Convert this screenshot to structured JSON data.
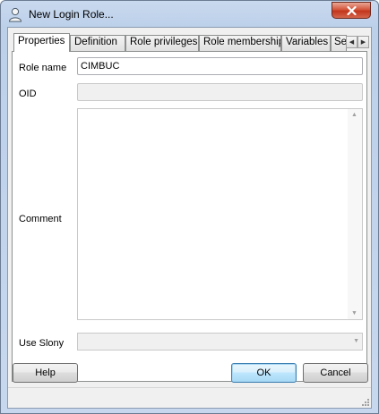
{
  "window": {
    "title": "New Login Role..."
  },
  "tabs": [
    {
      "label": "Properties",
      "active": true
    },
    {
      "label": "Definition"
    },
    {
      "label": "Role privileges"
    },
    {
      "label": "Role membership"
    },
    {
      "label": "Variables"
    },
    {
      "label": "Se"
    }
  ],
  "form": {
    "role_name": {
      "label": "Role name",
      "value": "CIMBUC"
    },
    "oid": {
      "label": "OID",
      "value": ""
    },
    "comment": {
      "label": "Comment",
      "value": ""
    },
    "use_slony": {
      "label": "Use Slony",
      "value": ""
    }
  },
  "buttons": {
    "help": "Help",
    "ok": "OK",
    "cancel": "Cancel"
  },
  "icons": {
    "title": "user-icon",
    "close": "close-icon",
    "scroll_left": "chevron-left-icon",
    "scroll_right": "chevron-right-icon",
    "dropdown": "chevron-down-icon"
  },
  "colors": {
    "close_button": "#c2361c",
    "title_gradient": "#bcd0ea",
    "default_button_border": "#3c7fb1"
  }
}
